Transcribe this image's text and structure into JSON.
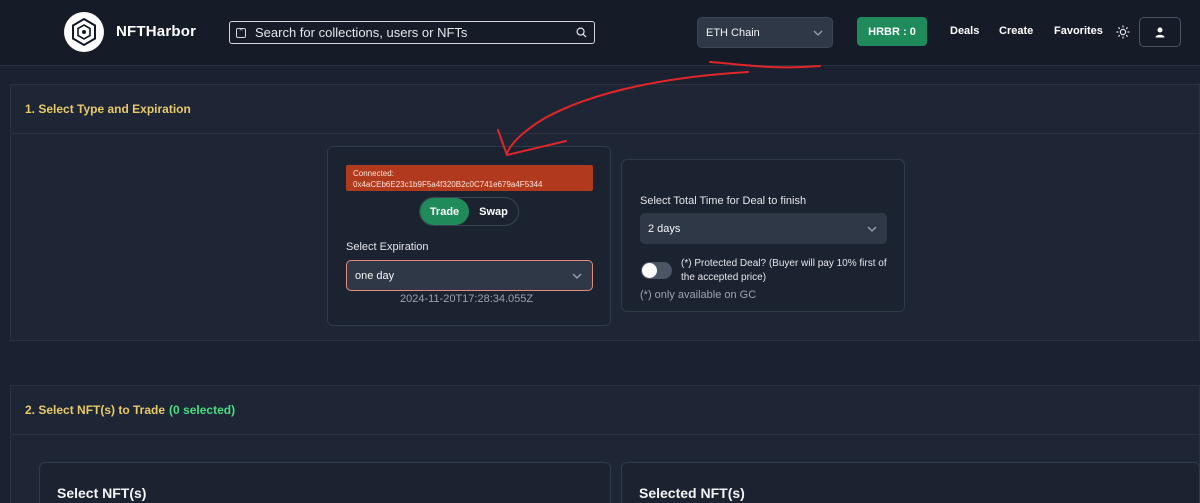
{
  "header": {
    "brand_nft": "NFT",
    "brand_harbor": "Harbor",
    "search_placeholder": "Search for collections, users or NFTs",
    "chain_select": "ETH Chain",
    "hrbr_label": "HRBR : 0",
    "nav": [
      "Deals",
      "Create",
      "Favorites"
    ]
  },
  "section1": {
    "title": "1. Select Type and Expiration",
    "connected_label": "Connected:",
    "wallet_address": "0x4aCEb6E23c1b9F5a4f320B2c0C741e679a4F5344",
    "type_options": [
      "Trade",
      "Swap"
    ],
    "active_type": "Trade",
    "expiration_label": "Select Expiration",
    "expiration_value": "one day",
    "expiration_timestamp": "2024-11-20T17:28:34.055Z",
    "deal_time_label": "Select Total Time for Deal to finish",
    "deal_time_value": "2 days",
    "protected_deal_text": "(*) Protected Deal? (Buyer will pay 10% first of the accepted price)",
    "protected_deal_enabled": false,
    "availability_note": "(*) only available on GC"
  },
  "section2": {
    "title": "2. Select NFT(s) to Trade",
    "selected_count_text": "(0 selected)",
    "left_card_title": "Select NFT(s)",
    "right_card_title": "Selected NFT(s)"
  },
  "colors": {
    "accent_green": "#1f8a5a",
    "section_title": "#e8c96a",
    "connected_bg": "#b0391e",
    "annotation": "#e0262a"
  },
  "icons": [
    "logo-icon",
    "search-icon",
    "chevron-down-icon",
    "sun-icon",
    "user-icon"
  ]
}
